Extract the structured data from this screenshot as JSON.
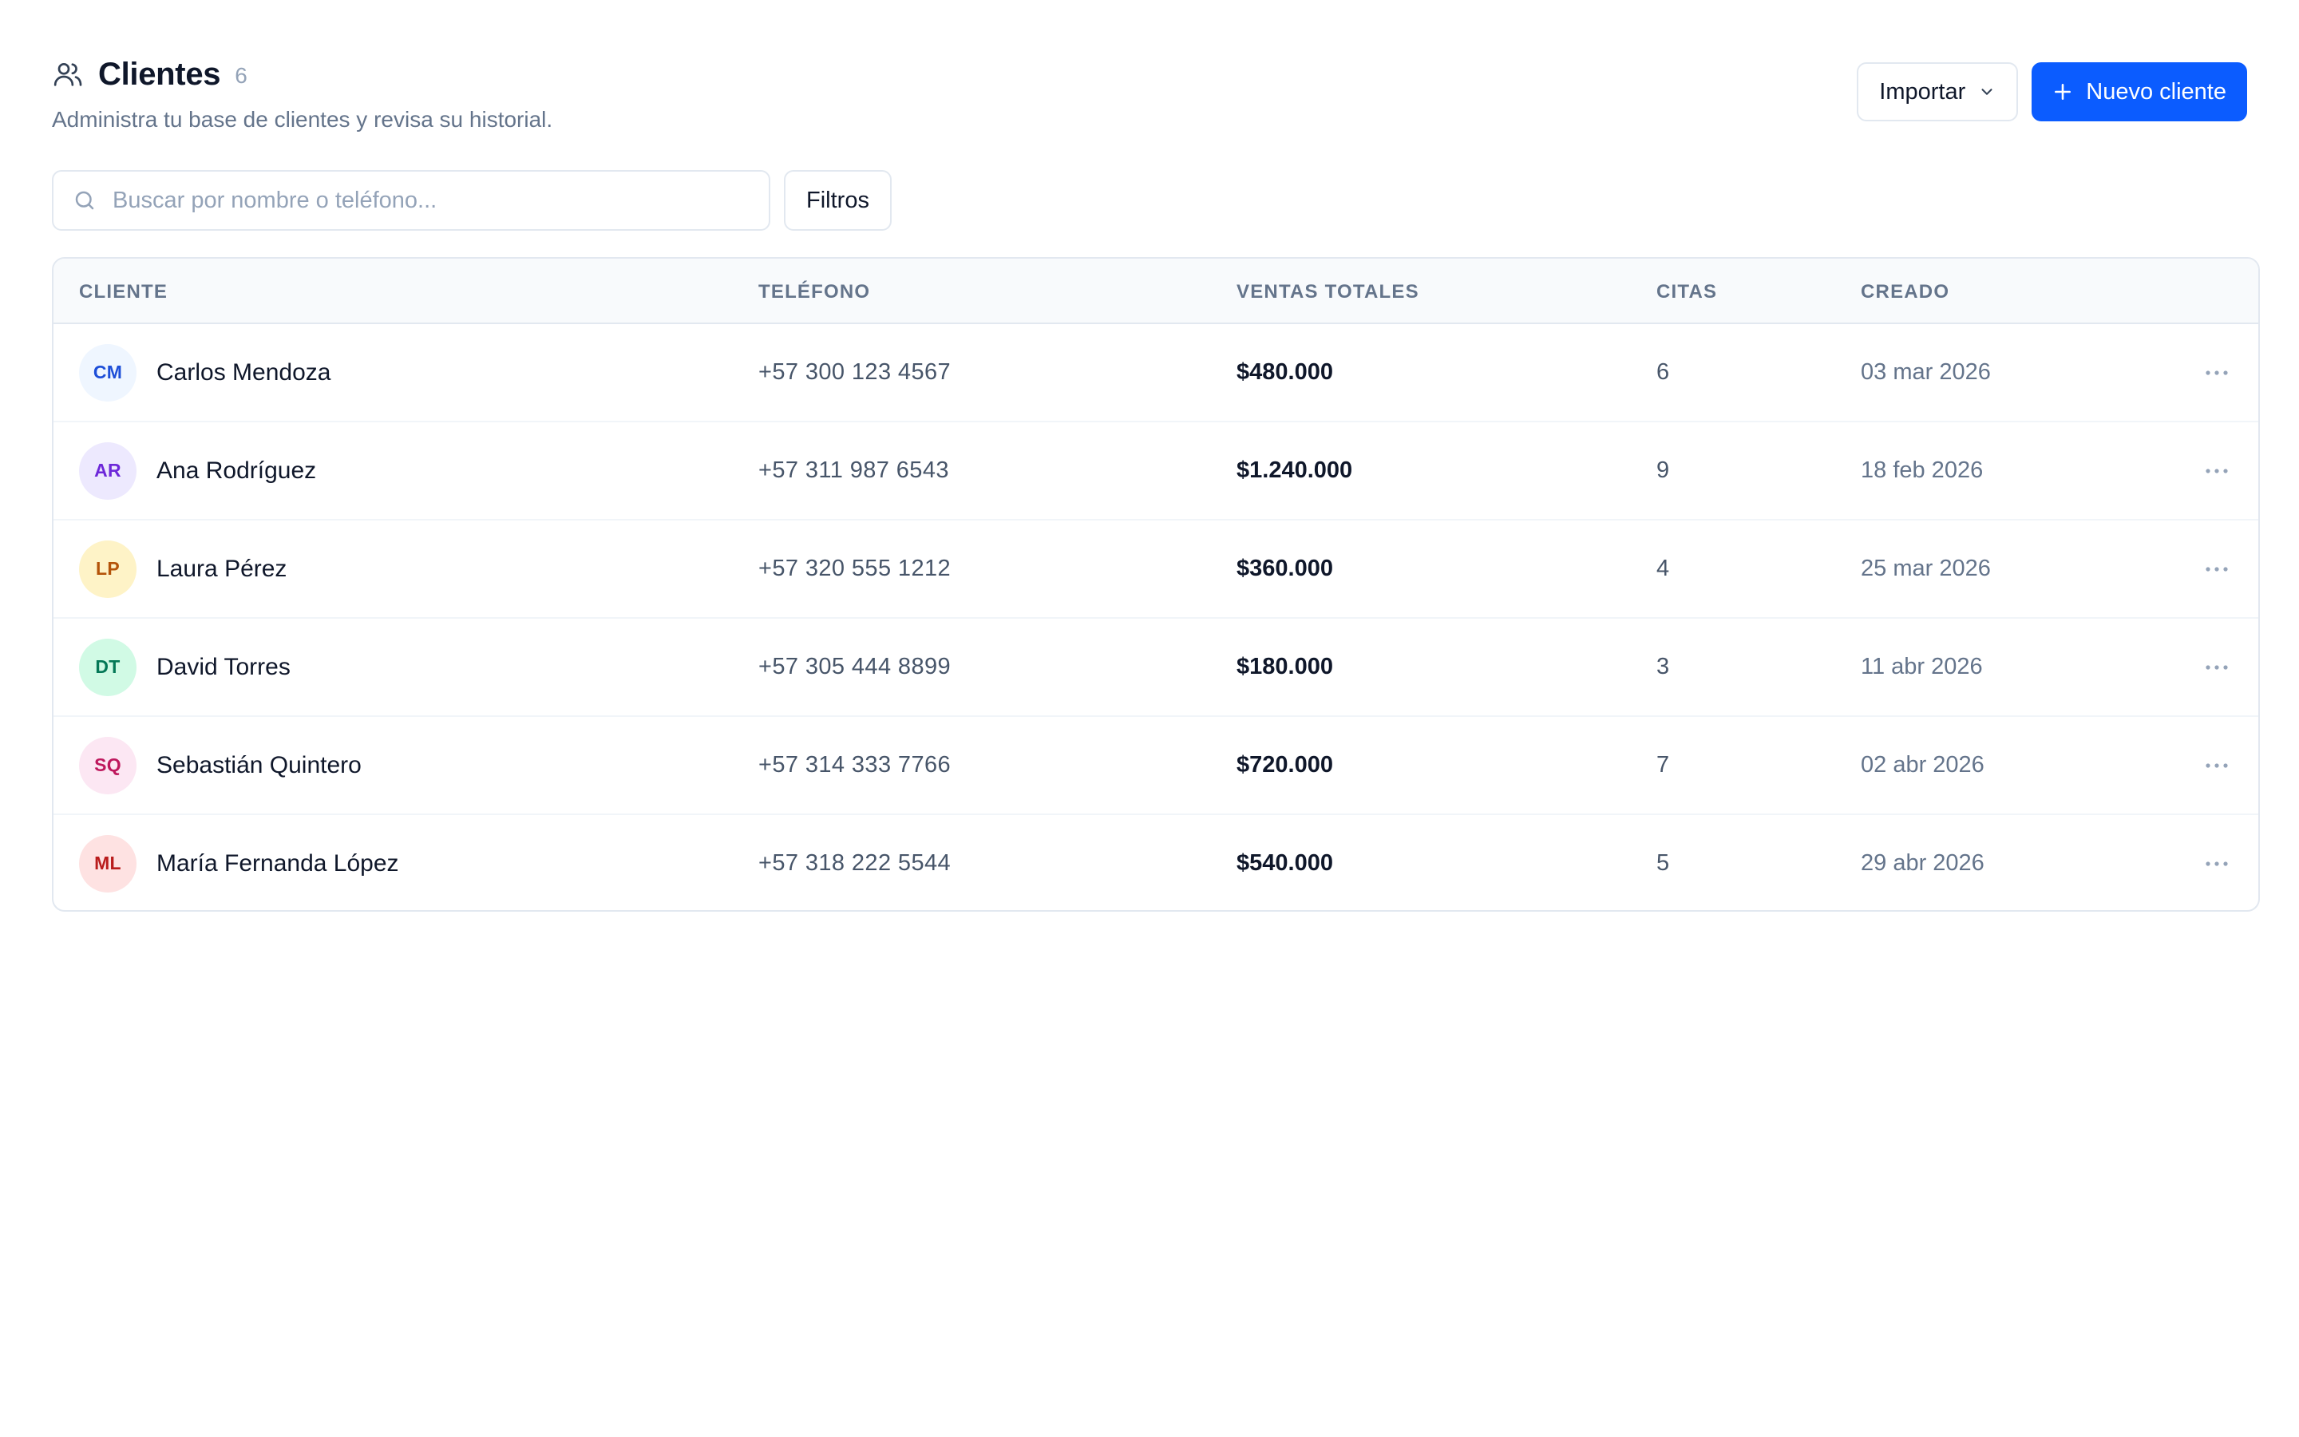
{
  "header": {
    "title": "Clientes",
    "count": "6",
    "subtitle": "Administra tu base de clientes y revisa su historial.",
    "import_label": "Importar",
    "new_label": "Nuevo cliente"
  },
  "toolbar": {
    "search_placeholder": "Buscar por nombre o teléfono...",
    "search_value": "",
    "filter_label": "Filtros"
  },
  "table": {
    "columns": [
      "CLIENTE",
      "TELÉFONO",
      "VENTAS TOTALES",
      "CITAS",
      "CREADO"
    ],
    "rows": [
      {
        "initials": "CM",
        "name": "Carlos Mendoza",
        "phone": "+57 300 123 4567",
        "sales": "$480.000",
        "citas": "6",
        "created": "03 mar 2026",
        "avatar_bg": "#eff6ff",
        "avatar_fg": "#1d4ed8"
      },
      {
        "initials": "AR",
        "name": "Ana Rodríguez",
        "phone": "+57 311 987 6543",
        "sales": "$1.240.000",
        "citas": "9",
        "created": "18 feb 2026",
        "avatar_bg": "#ede9fe",
        "avatar_fg": "#6d28d9"
      },
      {
        "initials": "LP",
        "name": "Laura Pérez",
        "phone": "+57 320 555 1212",
        "sales": "$360.000",
        "citas": "4",
        "created": "25 mar 2026",
        "avatar_bg": "#fef3c7",
        "avatar_fg": "#b45309"
      },
      {
        "initials": "DT",
        "name": "David Torres",
        "phone": "+57 305 444 8899",
        "sales": "$180.000",
        "citas": "3",
        "created": "11 abr 2026",
        "avatar_bg": "#d1fae5",
        "avatar_fg": "#047857"
      },
      {
        "initials": "SQ",
        "name": "Sebastián Quintero",
        "phone": "+57 314 333 7766",
        "sales": "$720.000",
        "citas": "7",
        "created": "02 abr 2026",
        "avatar_bg": "#fce7f3",
        "avatar_fg": "#be185d"
      },
      {
        "initials": "ML",
        "name": "María Fernanda López",
        "phone": "+57 318 222 5544",
        "sales": "$540.000",
        "citas": "5",
        "created": "29 abr 2026",
        "avatar_bg": "#fee2e2",
        "avatar_fg": "#b91c1c"
      }
    ]
  },
  "icons": {
    "title": "users-icon",
    "import_chevron": "chevron-down-icon",
    "new": "plus-icon",
    "search": "search-icon",
    "row_action": "more-horizontal-icon"
  },
  "colors": {
    "primary": "#0b5cff",
    "border": "#e2e8f0",
    "muted_text": "#64748b"
  }
}
